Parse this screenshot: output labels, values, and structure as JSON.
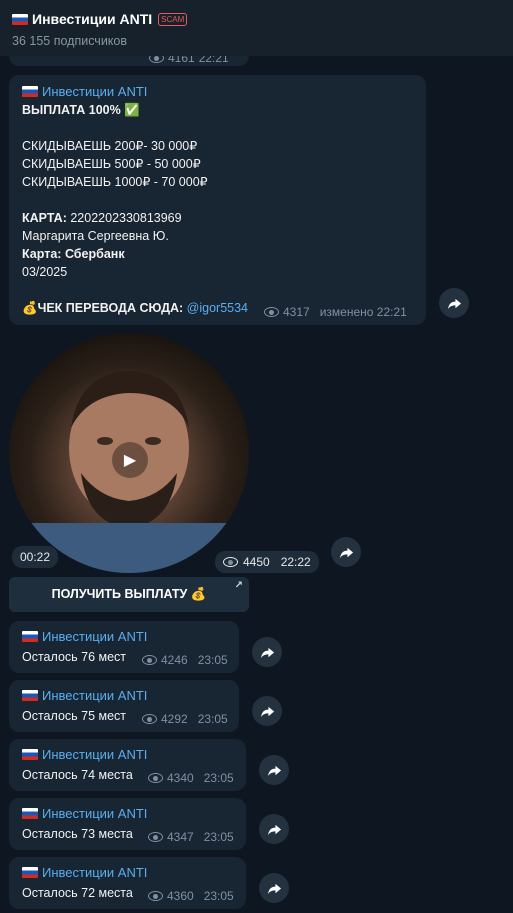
{
  "channel": {
    "name": "Инвестиции ANTI",
    "badge": "SCAM",
    "subscribers": "36 155 подписчиков"
  },
  "prev_meta": {
    "views": "4161",
    "time": "22:21"
  },
  "payout_post": {
    "author": "Инвестиции ANTI",
    "headline": "ВЫПЛАТА 100% ✅",
    "offers": [
      "СКИДЫВАЕШЬ 200₽- 30 000₽",
      "СКИДЫВАЕШЬ 500₽ - 50 000₽",
      "СКИДЫВАЕШЬ 1000₽ - 70 000₽"
    ],
    "card_label": "КАРТА:",
    "card_number": "2202202330813969",
    "card_holder": "Маргарита Сергеевна Ю.",
    "bank_label": "Карта:",
    "bank_name": "Сбербанк",
    "expiry": "03/2025",
    "receipt_prefix": "💰ЧЕК ПЕРЕВОДА СЮДА:",
    "receipt_handle": "@igor5534",
    "views": "4317",
    "edited": "изменено 22:21"
  },
  "video_message": {
    "duration": "00:22",
    "views": "4450",
    "time": "22:22",
    "button_label": "ПОЛУЧИТЬ ВЫПЛАТУ 💰"
  },
  "messages": [
    {
      "author": "Инвестиции ANTI",
      "text": "Осталось 76 мест",
      "views": "4246",
      "time": "23:05"
    },
    {
      "author": "Инвестиции ANTI",
      "text": "Осталось 75 мест",
      "views": "4292",
      "time": "23:05"
    },
    {
      "author": "Инвестиции ANTI",
      "text": "Осталось 74 места",
      "views": "4340",
      "time": "23:05"
    },
    {
      "author": "Инвестиции ANTI",
      "text": "Осталось 73 места",
      "views": "4347",
      "time": "23:05"
    },
    {
      "author": "Инвестиции ANTI",
      "text": "Осталось 72 места",
      "views": "4360",
      "time": "23:05"
    }
  ],
  "colors": {
    "background": "#0e1621",
    "bubble": "#182533",
    "accent": "#5aaeef",
    "scam": "#e35a5a"
  }
}
